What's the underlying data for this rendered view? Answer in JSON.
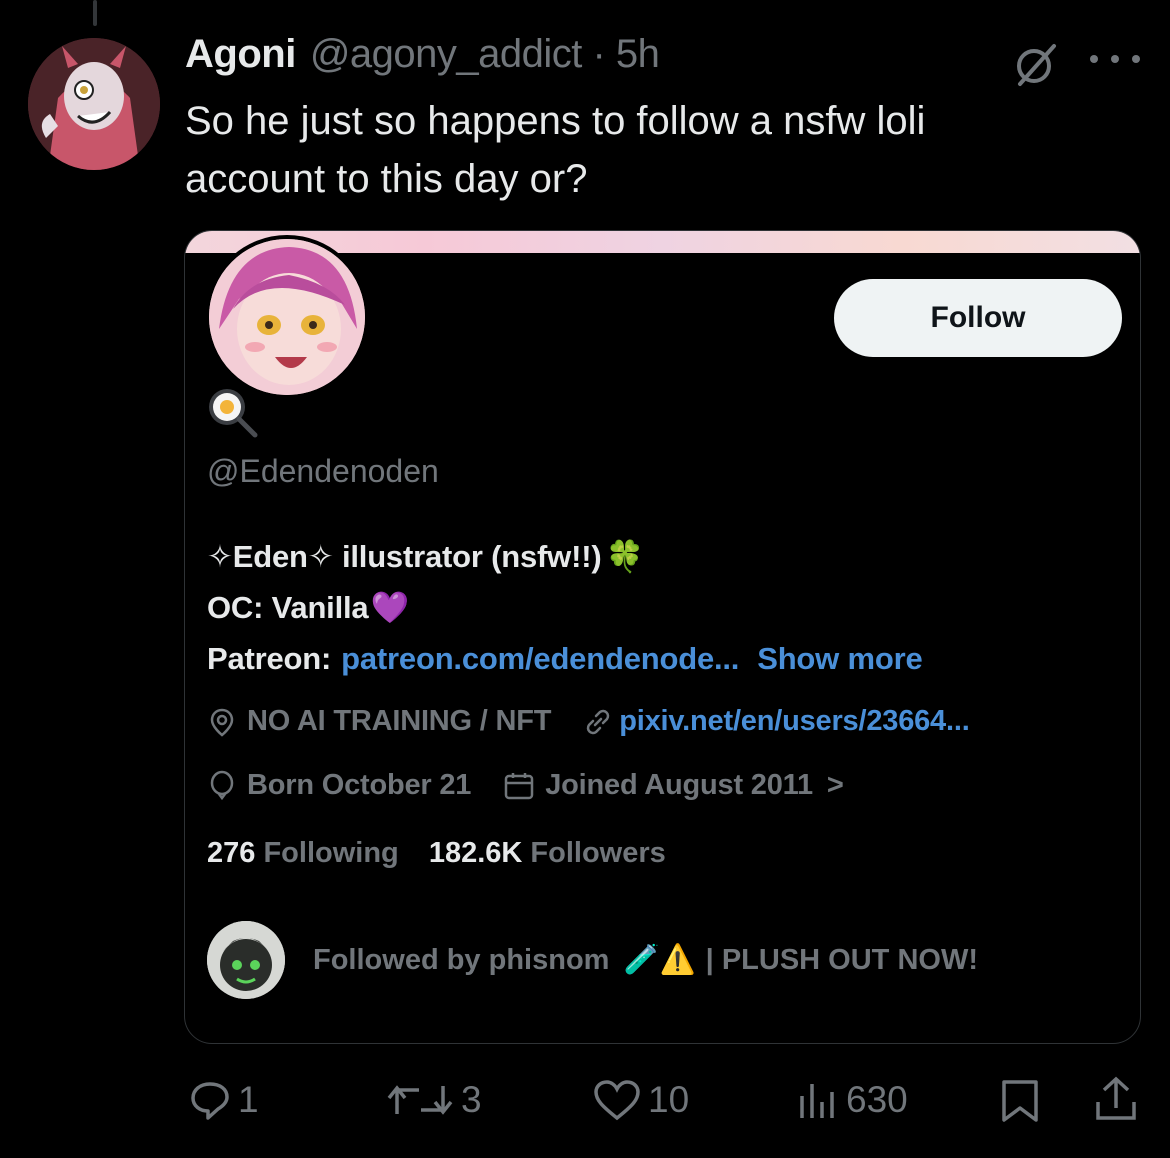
{
  "tweet": {
    "display_name": "Agoni",
    "handle_time": "@agony_addict · 5h",
    "text_line1": "So he just so happens to follow a nsfw loli",
    "text_line2": "account to this day or?"
  },
  "profile_card": {
    "follow_label": "Follow",
    "name_emoji": "🍳",
    "handle": "@Edendenoden",
    "bio_line1": "✧Eden✧ illustrator (nsfw!!)",
    "bio_line1_emoji": "🍀",
    "bio_line2": "OC: Vanilla",
    "bio_line2_emoji": "💜",
    "bio_patreon_label": "Patreon:",
    "bio_patreon_link": "patreon.com/edendenode...",
    "show_more": "Show more",
    "location": "NO AI TRAINING / NFT",
    "website": "pixiv.net/en/users/23664...",
    "birthday": "Born October 21",
    "joined": "Joined August 2011",
    "joined_chevron": ">",
    "following_count": "276",
    "following_label": "Following",
    "followers_count": "182.6K",
    "followers_label": "Followers",
    "followed_by": "Followed by phisnom",
    "followed_by_emoji": "🧪⚠️",
    "followed_by_suffix": "| PLUSH OUT NOW!"
  },
  "actions": {
    "replies": "1",
    "retweets": "3",
    "likes": "10",
    "views": "630"
  },
  "colors": {
    "background": "#000000",
    "text": "#e7e9ea",
    "muted": "#71767b",
    "link": "#4a8fd8",
    "border": "#2f3336",
    "button_bg": "#eff3f4"
  }
}
